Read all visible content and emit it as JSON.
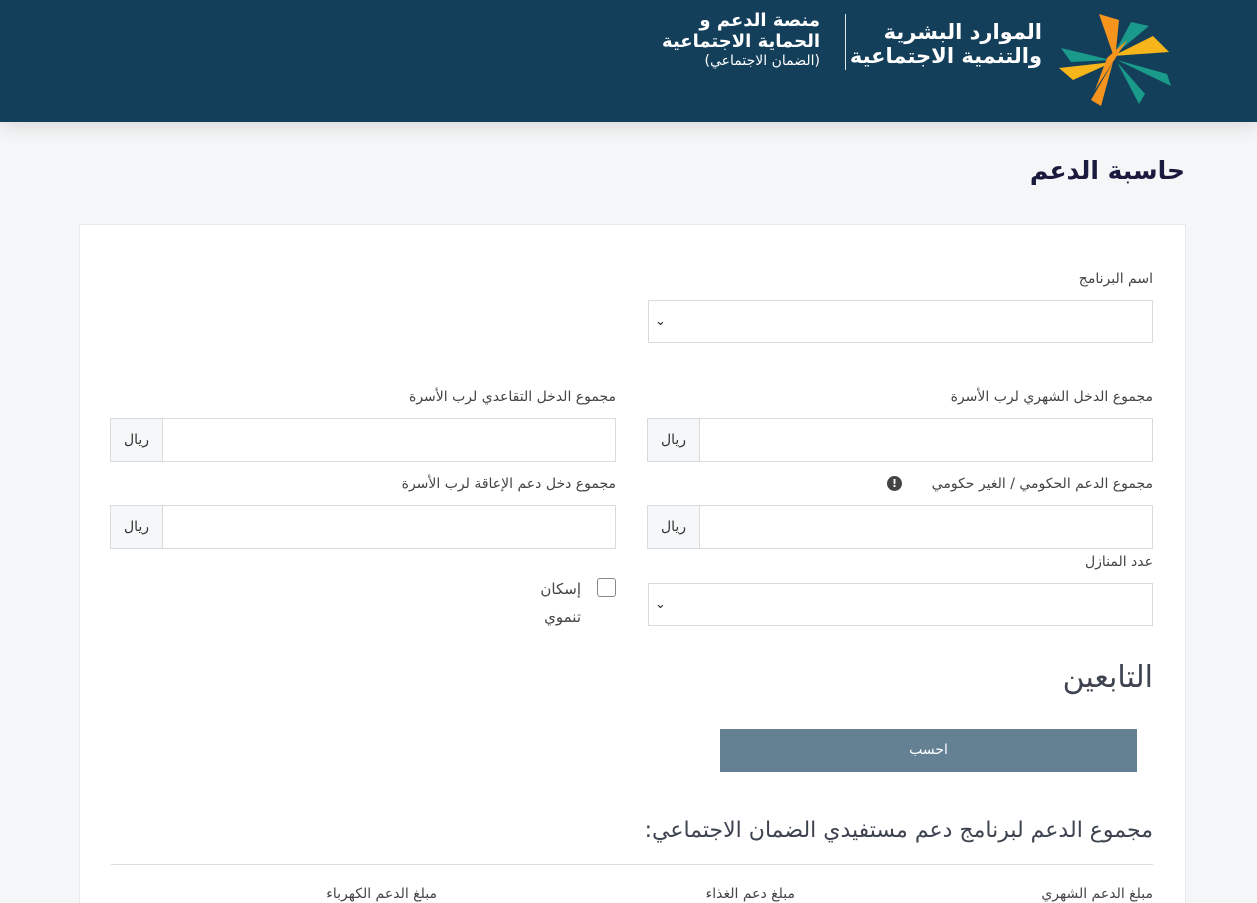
{
  "header": {
    "ministry_line1": "الموارد البشرية",
    "ministry_line2": "والتنمية الاجتماعية",
    "platform_line1": "منصة الدعم و",
    "platform_line2": "الحماية الاجتماعية",
    "platform_line3": "(الضمان الاجتماعي)",
    "logo_icon": "hrsd-leaf-star-logo"
  },
  "page": {
    "title": "حاسبة الدعم"
  },
  "form": {
    "program_name_label": "اسم البرنامج",
    "monthly_income_label": "مجموع الدخل الشهري لرب الأسرة",
    "retirement_income_label": "مجموع الدخل التقاعدي لرب الأسرة",
    "gov_support_label": "مجموع الدعم الحكومي / الغير حكومي",
    "disability_income_label": "مجموع دخل دعم الإعاقة لرب الأسرة",
    "houses_count_label": "عدد المنازل",
    "currency_addon": "ريال",
    "dev_housing_label_line1": "إسكان",
    "dev_housing_label_line2": "تنموي",
    "info_glyph": "!"
  },
  "dependents": {
    "title": "التابعين"
  },
  "actions": {
    "calculate_label": "احسب"
  },
  "results": {
    "title": "مجموع الدعم لبرنامج دعم مستفيدي الضمان الاجتماعي:",
    "monthly_support_label": "مبلغ الدعم الشهري",
    "food_support_label": "مبلغ دعم الغذاء",
    "electricity_support_label": "مبلغ الدعم الكهرباء"
  },
  "colors": {
    "header_bg": "#133f5a",
    "button_bg": "#648193",
    "logo_orange": "#f7941d",
    "logo_teal": "#1a9a8a",
    "logo_yellow": "#f5b51b"
  }
}
